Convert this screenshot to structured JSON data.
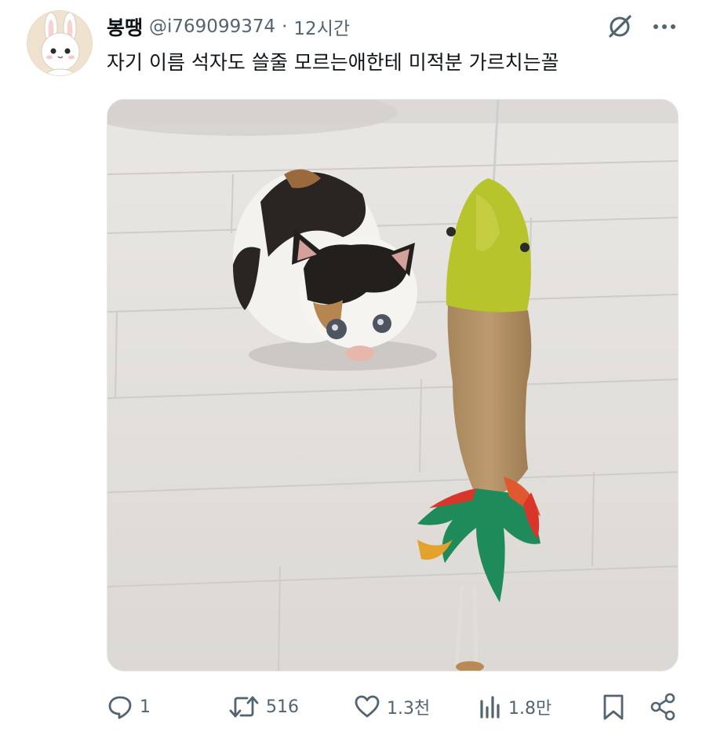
{
  "tweet": {
    "display_name": "봉땡",
    "handle": "@i769099374",
    "separator": "·",
    "time": "12시간",
    "text": "자기 이름 석자도 쓸줄 모르는애한테 미적분 가르치는꼴"
  },
  "actions": {
    "reply_count": "1",
    "retweet_count": "516",
    "like_count": "1.3천",
    "view_count": "1.8만"
  },
  "icons": {
    "grok": "grok-icon",
    "more": "more-icon",
    "reply": "reply-icon",
    "retweet": "retweet-icon",
    "like": "heart-icon",
    "views": "views-icon",
    "bookmark": "bookmark-icon",
    "share": "share-icon"
  },
  "colors": {
    "text_primary": "#0f1419",
    "text_secondary": "#536471"
  }
}
